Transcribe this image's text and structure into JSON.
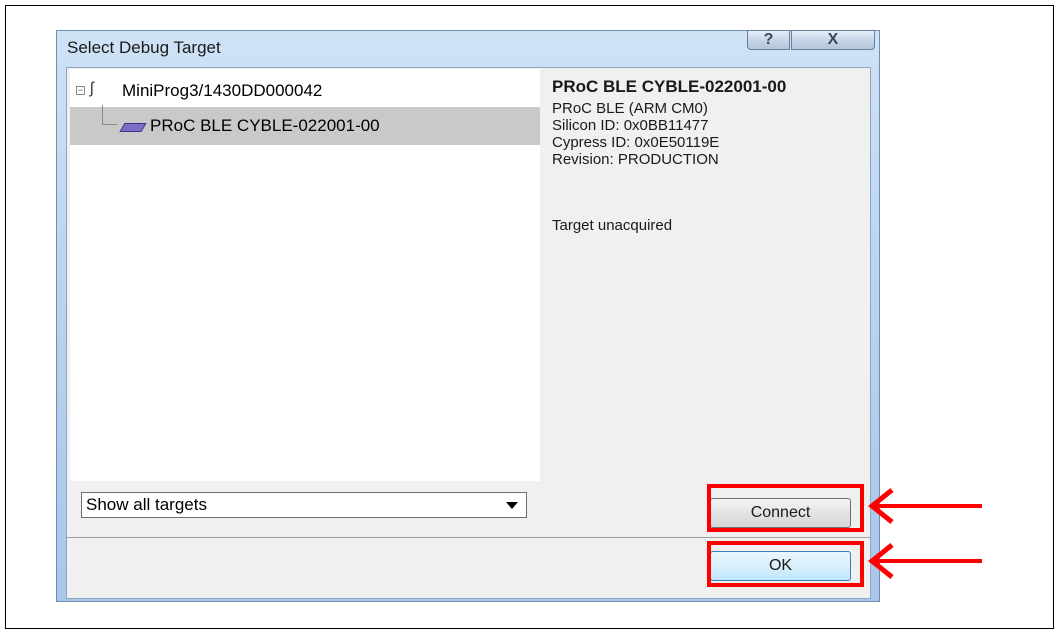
{
  "window": {
    "title": "Select Debug Target",
    "help_label": "?",
    "close_label": "X"
  },
  "tree": {
    "probe_label": "MiniProg3/1430DD000042",
    "target_label": "PRoC BLE CYBLE-022001-00",
    "expander_symbol": "−"
  },
  "info": {
    "header": "PRoC BLE CYBLE-022001-00",
    "line1": "PRoC BLE (ARM CM0)",
    "line2": "Silicon ID: 0x0BB11477",
    "line3": "Cypress ID: 0x0E50119E",
    "line4": "Revision: PRODUCTION",
    "status": "Target unacquired"
  },
  "filter": {
    "selected": "Show all targets"
  },
  "buttons": {
    "connect": "Connect",
    "ok": "OK"
  },
  "colors": {
    "annotation": "#ff0000",
    "selection": "#c9c9c9",
    "chip": "#7b6ec7"
  },
  "icons": {
    "probe": "usb-probe-icon",
    "chip": "chip-icon",
    "expander": "tree-collapse-icon"
  }
}
